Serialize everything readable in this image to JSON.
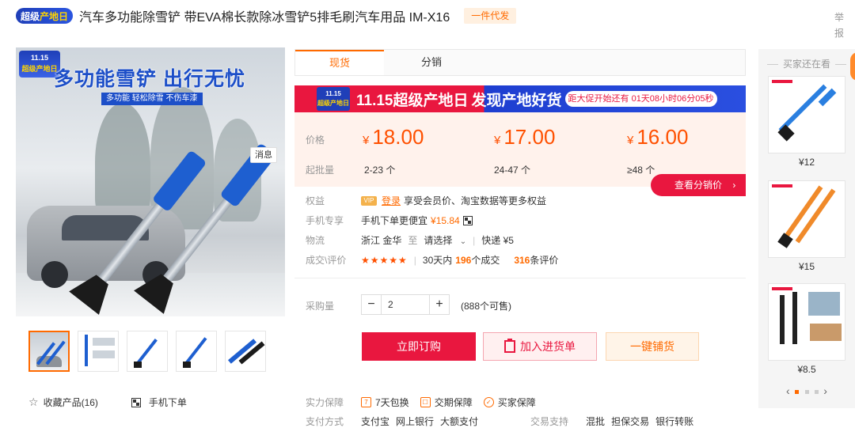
{
  "header": {
    "badge_part1": "超级",
    "badge_part2": "产地日",
    "title": "汽车多功能除雪铲 带EVA棉长款除冰雪铲5排毛刷汽车用品 IM-X16",
    "dropship_tag": "一件代发",
    "report_label": "举报"
  },
  "main_image": {
    "badge_date": "11.15",
    "badge_text": "超级产地日",
    "headline": "多功能雪铲 出行无忧",
    "subline": "多功能 轻松除雪 不伤车漆",
    "message_button": "消息"
  },
  "thumbnails": {
    "count": 5,
    "active_index": 0
  },
  "favorites": {
    "collect_label": "收藏产品",
    "collect_count": "(16)",
    "mobile_order_label": "手机下单"
  },
  "tabs": [
    {
      "label": "现货",
      "active": true
    },
    {
      "label": "分销",
      "active": false
    }
  ],
  "promo_banner": {
    "logo_date": "11.15",
    "logo_text": "超级产地日",
    "text1": "11.15超级产地日",
    "text2": "发现产地好货",
    "countdown": "距大促开始还有 01天08小时06分05秒"
  },
  "pricing": {
    "price_label": "价格",
    "batch_label": "起批量",
    "currency": "¥",
    "tiers": [
      {
        "price": "18.00",
        "range": "2-23 个"
      },
      {
        "price": "17.00",
        "range": "24-47 个"
      },
      {
        "price": "16.00",
        "range": "≥48 个"
      }
    ],
    "distribution_button": "查看分销价"
  },
  "attributes": {
    "rights_label": "权益",
    "vip_tag": "VIP",
    "login_link": "登录",
    "rights_text": "享受会员价、淘宝数据等更多权益",
    "mobile_label": "手机专享",
    "mobile_text": "手机下单更便宜",
    "mobile_price": "¥15.84",
    "logistics_label": "物流",
    "origin": "浙江 金华",
    "to_label": "至",
    "destination": "请选择",
    "express": "快递 ¥5",
    "deals_label": "成交\\评价",
    "stars": "★★★★★",
    "deals_prefix": "30天内",
    "deals_count": "196",
    "deals_suffix": "个成交",
    "reviews_count": "316",
    "reviews_suffix": "条评价"
  },
  "purchase": {
    "qty_label": "采购量",
    "minus": "−",
    "plus": "+",
    "quantity": "2",
    "stock_note": "(888个可售)",
    "order_button": "立即订购",
    "cart_button": "加入进货单",
    "list_button": "一键铺货"
  },
  "guarantees": {
    "label": "实力保障",
    "items": [
      "7天包换",
      "交期保障",
      "买家保障"
    ]
  },
  "payment": {
    "label": "支付方式",
    "methods": [
      "支付宝",
      "网上银行",
      "大额支付"
    ],
    "trade_label": "交易支持",
    "trade_methods": [
      "混批",
      "担保交易",
      "银行转账"
    ]
  },
  "recommendations": {
    "title": "买家还在看",
    "items": [
      {
        "price": "¥12"
      },
      {
        "price": "¥15"
      },
      {
        "price": "¥8.5"
      }
    ],
    "pager_prev": "‹",
    "pager_next": "›",
    "pager_current": 0,
    "pager_total": 3
  },
  "colors": {
    "accent": "#ff6a00",
    "promo_red": "#e9173f",
    "promo_blue": "#1f3fb8",
    "price": "#ff5000"
  }
}
